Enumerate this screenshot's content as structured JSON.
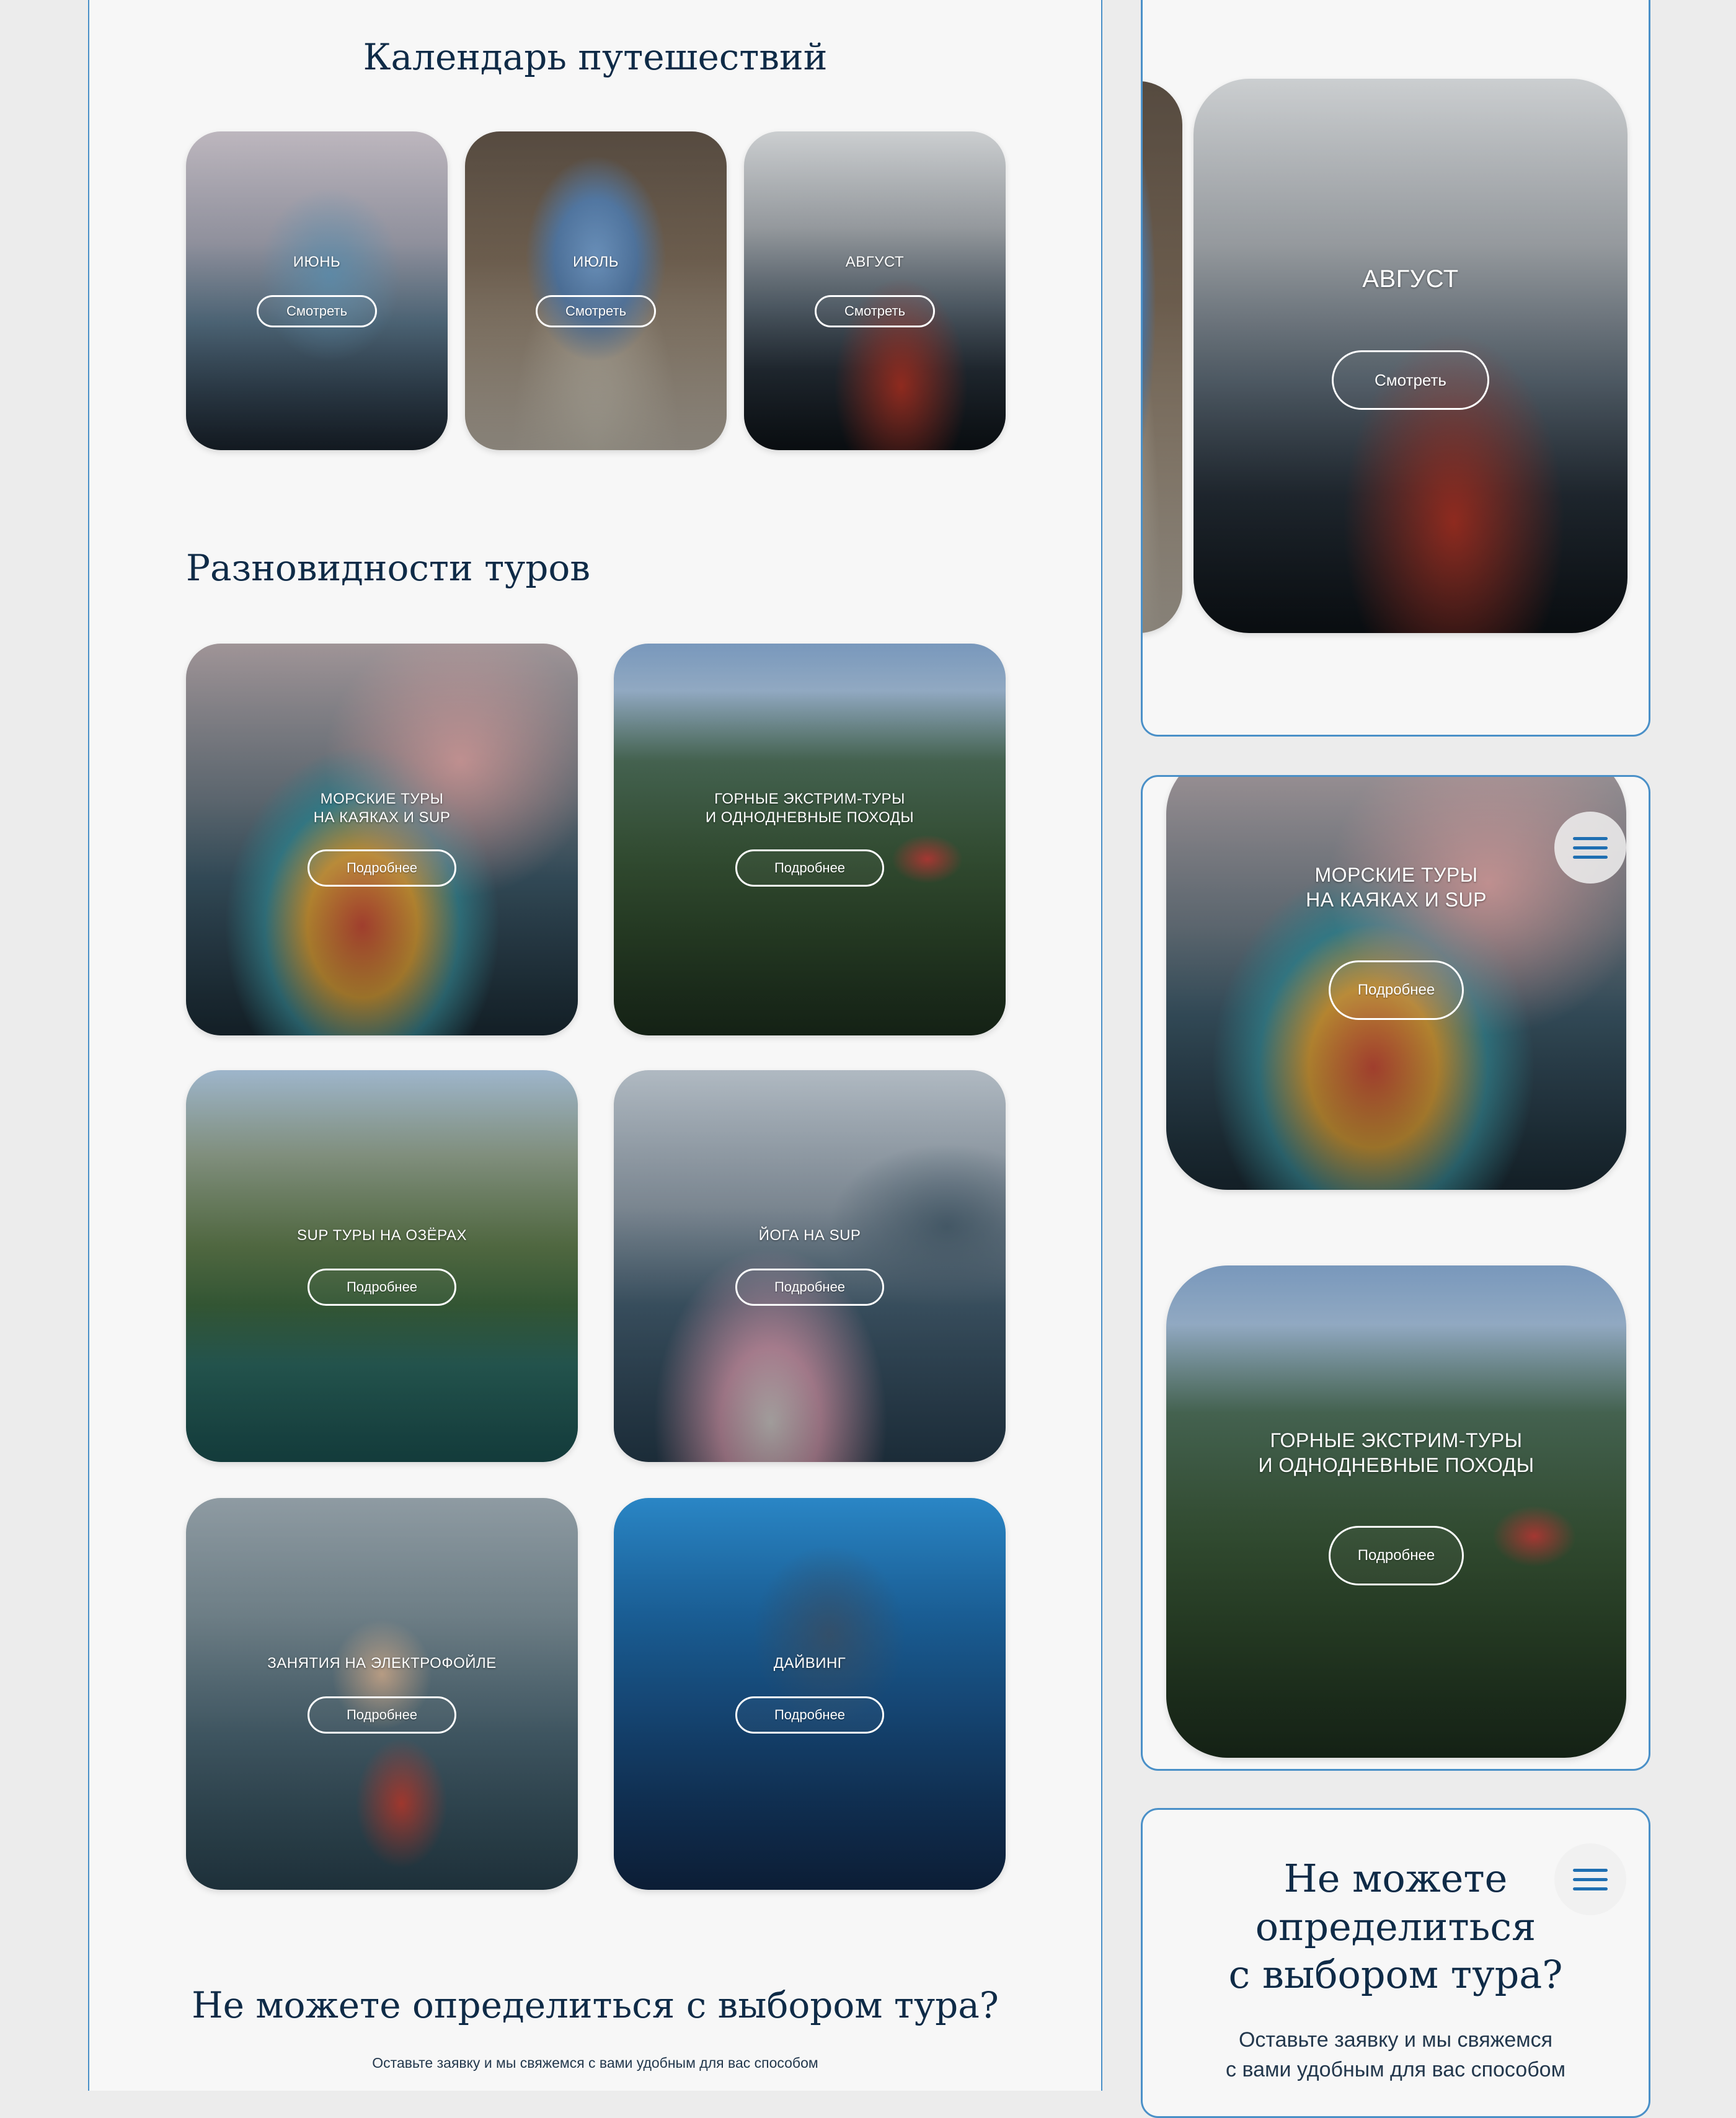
{
  "calendar": {
    "heading": "Календарь путешествий",
    "cards": [
      {
        "label": "ИЮНЬ",
        "button": "Смотреть"
      },
      {
        "label": "ИЮЛЬ",
        "button": "Смотреть"
      },
      {
        "label": "АВГУСТ",
        "button": "Смотреть"
      }
    ]
  },
  "tours": {
    "heading": "Разновидности туров",
    "cards": [
      {
        "title_line1": "МОРСКИЕ ТУРЫ",
        "title_line2": "НА КАЯКАХ И SUP",
        "button": "Подробнее"
      },
      {
        "title_line1": "ГОРНЫЕ ЭКСТРИМ-ТУРЫ",
        "title_line2": "И ОДНОДНЕВНЫЕ ПОХОДЫ",
        "button": "Подробнее"
      },
      {
        "title_line1": "SUP ТУРЫ НА ОЗЁРАХ",
        "title_line2": "",
        "button": "Подробнее"
      },
      {
        "title_line1": "ЙОГА НА SUP",
        "title_line2": "",
        "button": "Подробнее"
      },
      {
        "title_line1": "ЗАНЯТИЯ НА ЭЛЕКТРОФОЙЛЕ",
        "title_line2": "",
        "button": "Подробнее"
      },
      {
        "title_line1": "ДАЙВИНГ",
        "title_line2": "",
        "button": "Подробнее"
      }
    ]
  },
  "cta": {
    "heading": "Не можете определиться с выбором тура?",
    "text": "Оставьте заявку и мы свяжемся с вами удобным для вас способом"
  },
  "mobile": {
    "calendar_card": {
      "label": "АВГУСТ",
      "button": "Смотреть"
    },
    "tour_card_1": {
      "title_line1": "МОРСКИЕ ТУРЫ",
      "title_line2": "НА КАЯКАХ И SUP",
      "button": "Подробнее"
    },
    "tour_card_2": {
      "title_line1": "ГОРНЫЕ ЭКСТРИМ-ТУРЫ",
      "title_line2": "И ОДНОДНЕВНЫЕ ПОХОДЫ",
      "button": "Подробнее"
    },
    "cta": {
      "heading_line1": "Не можете",
      "heading_line2": "определиться",
      "heading_line3": "с выбором тура?",
      "text_line1": "Оставьте заявку и мы свяжемся",
      "text_line2": "с вами удобным для вас способом"
    },
    "menu_icon": "hamburger-menu-icon"
  },
  "colors": {
    "accent": "#1f6fb2",
    "heading": "#0f2b47",
    "frame_border": "#4a90c8",
    "background": "#f7f7f7"
  }
}
